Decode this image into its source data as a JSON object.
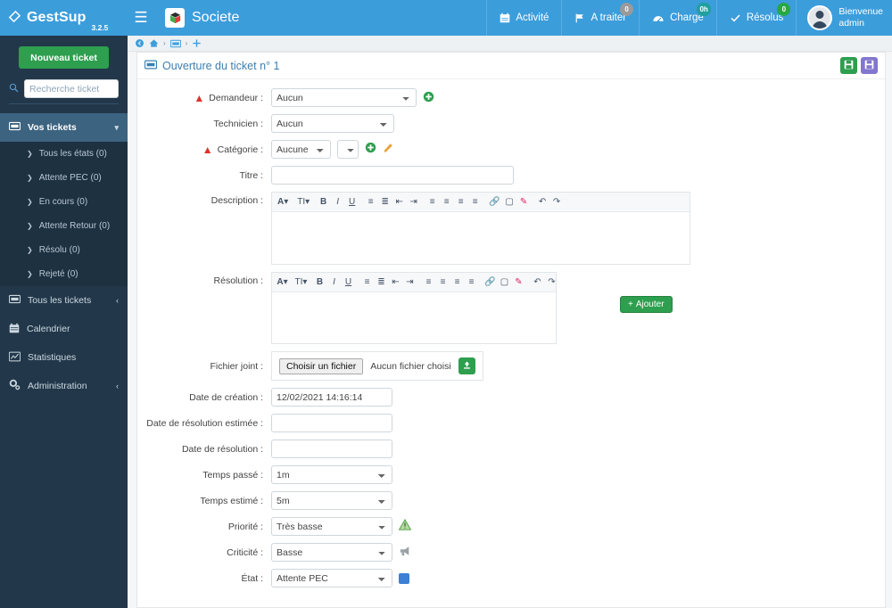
{
  "topbar": {
    "brand": "GestSup",
    "version": "3.2.5",
    "menu_icon": "hamburger-icon",
    "site_name": "Societe",
    "nav": [
      {
        "label": "Activité",
        "icon": "calendar-icon",
        "badge": null,
        "badge_color": null
      },
      {
        "label": "A traiter",
        "icon": "flag-icon",
        "badge": "0",
        "badge_color": "#9a9a9a"
      },
      {
        "label": "Charge",
        "icon": "gauge-icon",
        "badge": "0h",
        "badge_color": "#21a0a0"
      },
      {
        "label": "Résolus",
        "icon": "check-icon",
        "badge": "0",
        "badge_color": "#27a745"
      }
    ],
    "user": {
      "greeting": "Bienvenue",
      "name": "admin",
      "avatar": "user-avatar"
    }
  },
  "sidebar": {
    "new_ticket_label": "Nouveau ticket",
    "search_placeholder": "Recherche ticket",
    "search_value": "",
    "section_label": "Vos tickets",
    "sub_items": [
      {
        "label": "Tous les états (0)"
      },
      {
        "label": "Attente PEC (0)"
      },
      {
        "label": "En cours (0)"
      },
      {
        "label": "Attente Retour (0)"
      },
      {
        "label": "Résolu (0)"
      },
      {
        "label": "Rejeté (0)"
      }
    ],
    "items": [
      {
        "label": "Tous les tickets",
        "icon": "ticket-icon",
        "chevron": "‹"
      },
      {
        "label": "Calendrier",
        "icon": "calendar-icon",
        "chevron": ""
      },
      {
        "label": "Statistiques",
        "icon": "chart-icon",
        "chevron": ""
      },
      {
        "label": "Administration",
        "icon": "gears-icon",
        "chevron": "‹"
      }
    ]
  },
  "breadcrumb": {
    "items": [
      "back-icon",
      "home-icon",
      "ticket-icon",
      "plus-icon"
    ],
    "separator": "›"
  },
  "panel": {
    "title": "Ouverture du ticket n° 1",
    "title_icon": "ticket-icon",
    "save_green_icon": "save-icon",
    "save_purple_icon": "save-icon"
  },
  "form": {
    "demandeur": {
      "label": "Demandeur :",
      "value": "Aucun",
      "required": true,
      "add_icon": "plus-circle-icon"
    },
    "technicien": {
      "label": "Technicien :",
      "value": "Aucun"
    },
    "categorie": {
      "label": "Catégorie :",
      "value": "Aucune",
      "value2": "",
      "required": true,
      "add_icon": "plus-circle-icon",
      "edit_icon": "pencil-icon"
    },
    "titre": {
      "label": "Titre :",
      "value": ""
    },
    "description": {
      "label": "Description :",
      "value": ""
    },
    "resolution": {
      "label": "Résolution :",
      "value": "",
      "add_label": "Ajouter"
    },
    "fichier": {
      "label": "Fichier joint :",
      "choose_label": "Choisir un fichier",
      "no_file_label": "Aucun fichier choisi",
      "upload_icon": "upload-icon"
    },
    "date_creation": {
      "label": "Date de création :",
      "value": "12/02/2021 14:16:14"
    },
    "date_resolution_estimee": {
      "label": "Date de résolution estimée :",
      "value": ""
    },
    "date_resolution": {
      "label": "Date de résolution :",
      "value": ""
    },
    "temps_passe": {
      "label": "Temps passé :",
      "value": "1m"
    },
    "temps_estime": {
      "label": "Temps estimé :",
      "value": "5m"
    },
    "priorite": {
      "label": "Priorité :",
      "value": "Très basse",
      "icon": "warning-triangle-icon"
    },
    "criticite": {
      "label": "Criticité :",
      "value": "Basse",
      "icon": "megaphone-icon"
    },
    "etat": {
      "label": "État :",
      "value": "Attente PEC",
      "icon": "blue-square-icon"
    }
  },
  "editor_toolbar": {
    "buttons": [
      "font-color-icon",
      "font-size-icon",
      "bold-icon",
      "italic-icon",
      "underline-icon",
      "bullet-list-icon",
      "numbered-list-icon",
      "outdent-icon",
      "indent-icon",
      "align-left-icon",
      "align-center-icon",
      "align-right-icon",
      "align-justify-icon",
      "link-icon",
      "image-icon",
      "highlighter-icon",
      "undo-icon",
      "redo-icon"
    ]
  }
}
